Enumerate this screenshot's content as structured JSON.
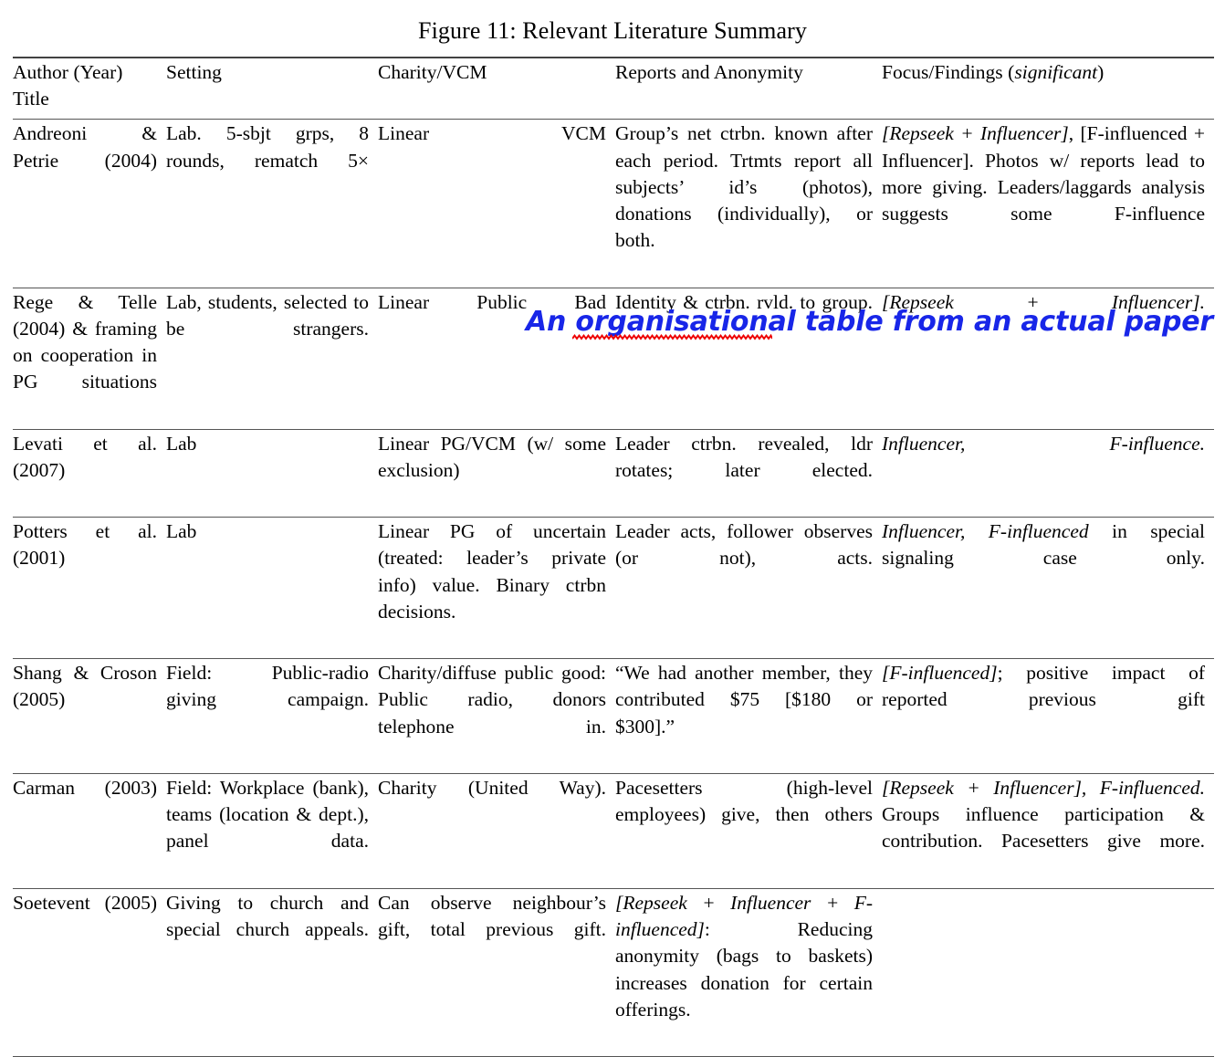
{
  "figure": {
    "caption": "Figure 11: Relevant Literature Summary"
  },
  "annotation": {
    "text": "An organisational table from an actual paper",
    "color": "#1826e8",
    "spellcheck_color": "#ee0000",
    "spellcheck_word": "organisational"
  },
  "table": {
    "headers": [
      "Author (Year) Title",
      "Setting",
      "Charity/VCM",
      "Reports and Anonymity",
      "Focus/Findings (significant)"
    ],
    "header_parts": {
      "col1_line1": "Author (Year)",
      "col1_line2": "Title",
      "col2": "Setting",
      "col3": "Charity/VCM",
      "col4": "Reports and Anonymity",
      "col5_plain": "Focus/Findings (",
      "col5_italic": "significant",
      "col5_close": ")"
    },
    "rows": [
      {
        "author": "Andreoni & Petrie (2004)",
        "setting": "Lab. 5-sbjt grps, 8 rounds, rematch 5×",
        "charity_vcm": "Linear VCM",
        "reports_anonymity": "Group’s net ctrbn. known after each period. Trtmts report all subjects’ id’s (photos), donations (individually), or both.",
        "focus_findings_italic": "[Repseek + Influencer]",
        "focus_findings_rest": ", [F-influenced + Influencer]. Photos w/ reports lead to more giving. Leaders/laggards analysis suggests some F-influence"
      },
      {
        "author": "Rege & Telle (2004) & framing on cooperation in PG situations",
        "setting": "Lab, students, selected to be strangers.",
        "charity_vcm": "Linear Public Bad",
        "reports_anonymity": "Identity & ctrbn. rvld. to group.",
        "focus_findings_italic": "[Repseek + Influencer].",
        "focus_findings_rest": ""
      },
      {
        "author": "Levati et al. (2007)",
        "setting": "Lab",
        "charity_vcm": "Linear PG/VCM (w/ some exclusion)",
        "reports_anonymity": "Leader ctrbn. revealed, ldr rotates; later elected.",
        "focus_findings_italic": "Influencer, F-influence.",
        "focus_findings_rest": ""
      },
      {
        "author": "Potters et al. (2001)",
        "setting": "Lab",
        "charity_vcm": "Linear PG of uncertain (treated: leader’s private info) value. Binary ctrbn decisions.",
        "reports_anonymity": "Leader acts, follower observes (or not), acts.",
        "focus_findings_italic": "Influencer, F-influenced",
        "focus_findings_rest": " in special signaling case only."
      },
      {
        "author": "Shang & Croson (2005)",
        "setting": "Field: Public-radio giving campaign.",
        "charity_vcm": "Charity/diffuse public good: Public radio, donors telephone in.",
        "reports_anonymity": "“We had another member, they contributed $75 [$180 or $300].”",
        "focus_findings_italic": "[F-influenced]",
        "focus_findings_rest": "; positive impact of reported previous gift"
      },
      {
        "author": "Carman (2003)",
        "setting": "Field: Workplace (bank), teams (location & dept.), panel data.",
        "charity_vcm": "Charity (United Way).",
        "reports_anonymity": "Pacesetters (high-level employees) give, then others",
        "focus_findings_italic": "[Repseek + Influencer], F-influenced.",
        "focus_findings_rest": " Groups influence participation & contribution. Pacesetters give more."
      },
      {
        "author": "Soetevent (2005)",
        "setting": "Giving to church and special church appeals.",
        "charity_vcm": "Can observe neighbour’s gift, total previous gift.",
        "reports_anonymity_italic": "[Repseek + Influencer + F-influenced]",
        "reports_anonymity_rest": ": Reducing anonymity (bags to baskets) increases donation for certain offerings.",
        "focus_findings_italic": "",
        "focus_findings_rest": ""
      }
    ]
  }
}
